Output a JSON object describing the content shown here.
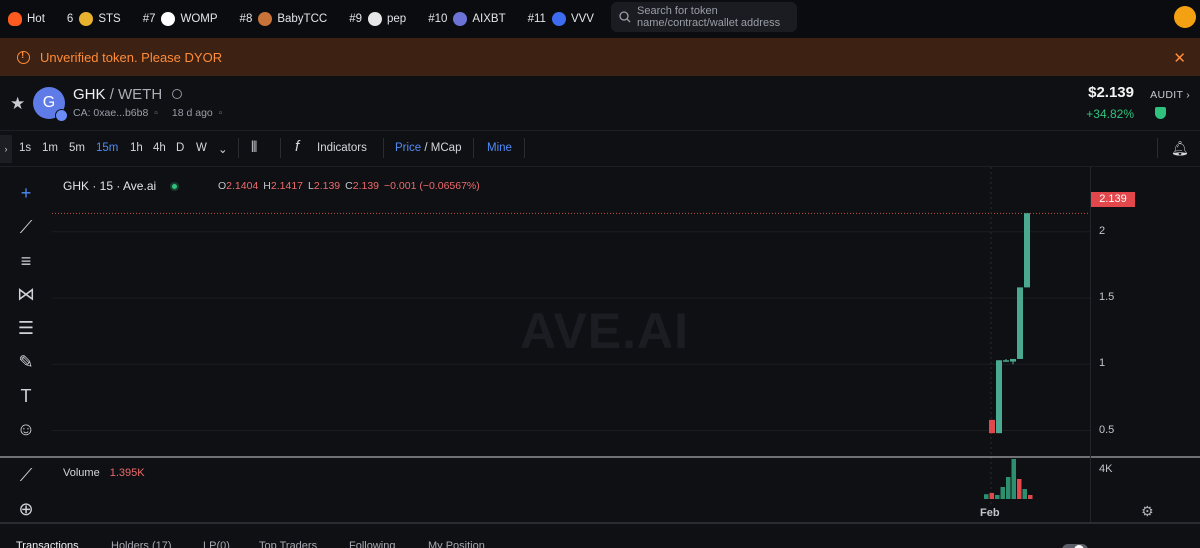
{
  "ticker": [
    {
      "rank": "",
      "label": "Hot",
      "icon": "fire-icon",
      "color": "#ff5a1f"
    },
    {
      "rank": "6",
      "label": "STS",
      "icon": "sts-token-icon",
      "color": "#e8b12e"
    },
    {
      "rank": "#7",
      "label": "WOMP",
      "icon": "womp-token-icon",
      "color": "#ffffff"
    },
    {
      "rank": "#8",
      "label": "BabyTCC",
      "icon": "babytcc-token-icon",
      "color": "#c9733a"
    },
    {
      "rank": "#9",
      "label": "pep",
      "icon": "pep-token-icon",
      "color": "#e6e6e6"
    },
    {
      "rank": "#10",
      "label": "AIXBT",
      "icon": "aixbt-token-icon",
      "color": "#6c73d6"
    },
    {
      "rank": "#11",
      "label": "VVV",
      "icon": "vvv-token-icon",
      "color": "#3e6cf0"
    }
  ],
  "search": {
    "line1": "Search for token",
    "line2": "name/contract/wallet address"
  },
  "warning": {
    "text": "Unverified token. Please DYOR"
  },
  "token": {
    "avatar_letter": "G",
    "symbol": "GHK",
    "pair": "/ WETH",
    "contract": "CA: 0xae...b6b8",
    "age": "18 d ago",
    "price": "$2.139",
    "change": "+34.82%",
    "audit": "AUDIT"
  },
  "toolbar": {
    "intervals": [
      "1s",
      "1m",
      "5m",
      "15m",
      "1h",
      "4h",
      "D",
      "W"
    ],
    "active_interval": "15m",
    "indicators": "Indicators",
    "price": "Price",
    "mcap": "/ MCap",
    "mine": "Mine"
  },
  "chart": {
    "legend": "GHK · 15 · Ave.ai",
    "ohlc": [
      {
        "k": "O",
        "v": "2.1404"
      },
      {
        "k": "H",
        "v": "2.1417"
      },
      {
        "k": "L",
        "v": "2.139"
      },
      {
        "k": "C",
        "v": "2.139"
      }
    ],
    "delta": "−0.001 (−0.06567%)",
    "watermark": "AVE.AI",
    "current_price_tag": "2.139",
    "y_ticks": [
      "2",
      "1.5",
      "1",
      "0.5"
    ],
    "volume_label": "Volume",
    "volume_value": "1.395K",
    "volume_tick": "4K",
    "x_label": "Feb"
  },
  "chart_data": {
    "type": "candlestick",
    "ylim": [
      0.3,
      2.3
    ],
    "current_price": 2.139,
    "candles": [
      {
        "o": 0.58,
        "h": 0.58,
        "l": 0.48,
        "c": 0.48,
        "up": false
      },
      {
        "o": 0.48,
        "h": 1.03,
        "l": 0.48,
        "c": 1.03,
        "up": true
      },
      {
        "o": 1.03,
        "h": 1.04,
        "l": 1.02,
        "c": 1.03,
        "up": true
      },
      {
        "o": 1.02,
        "h": 1.04,
        "l": 1.0,
        "c": 1.04,
        "up": true
      },
      {
        "o": 1.04,
        "h": 1.58,
        "l": 1.04,
        "c": 1.58,
        "up": true
      },
      {
        "o": 1.58,
        "h": 2.14,
        "l": 1.58,
        "c": 2.14,
        "up": true
      }
    ],
    "volume": [
      0.12,
      0.15,
      0.1,
      0.3,
      0.55,
      1.0,
      0.5,
      0.25,
      0.1
    ],
    "volume_colors": [
      "#2e8f6e",
      "#e2474b",
      "#2e8f6e",
      "#2e8f6e",
      "#2e8f6e",
      "#2e8f6e",
      "#e2474b",
      "#2e8f6e",
      "#e2474b"
    ]
  },
  "tabs": [
    "Transactions",
    "Holders (17)",
    "LP(0)",
    "Top Traders",
    "Following",
    "My Position"
  ],
  "colors": {
    "up": "#4aa991",
    "down": "#e2474b",
    "accent": "#4f8cf7",
    "warning": "#ff8c3a"
  }
}
